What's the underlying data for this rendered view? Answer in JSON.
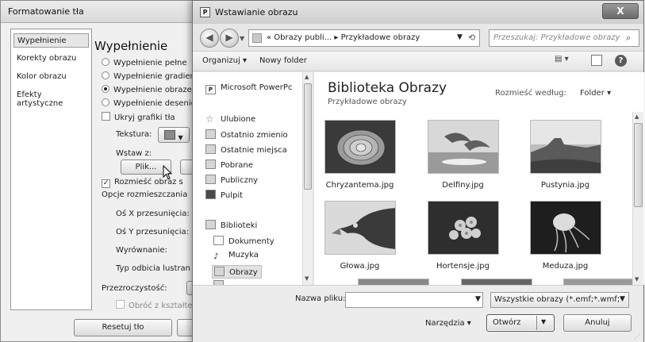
{
  "format_dialog": {
    "title": "Formatowanie tła",
    "nav": [
      "Wypełnienie",
      "Korekty obrazu",
      "Kolor obrazu",
      "Efekty artystyczne"
    ],
    "heading": "Wypełnienie",
    "fill_options": [
      "Wypełnienie pełne",
      "Wypełnienie gradient",
      "Wypełnienie obrazem",
      "Wypełnienie desenie"
    ],
    "hide_graphics": "Ukryj grafiki tła",
    "texture_label": "Tekstura:",
    "insert_from": "Wstaw z:",
    "file_button": "Plik...",
    "tile_checkbox": "Rozmieść obraz s",
    "tile_options": "Opcje rozmieszczania",
    "offset_x": "Oś X przesunięcia:",
    "offset_y": "Oś Y przesunięcia:",
    "alignment": "Wyrównanie:",
    "mirror_type": "Typ odbicia lustran",
    "transparency": "Przezroczystość:",
    "rotate_with_shape": "Obróć z kształtem",
    "reset_button": "Resetuj tło"
  },
  "insert_dialog": {
    "title": "Wstawianie obrazu",
    "app_icon_letter": "P",
    "close_glyph": "X",
    "address": "« Obrazy publi... ▸ Przykładowe obrazy",
    "search_placeholder": "Przeszukaj: Przykładowe obrazy",
    "toolbar": {
      "organize": "Organizuj ▾",
      "new_folder": "Nowy folder"
    },
    "nav_pane": [
      {
        "label": "Microsoft PowerPc",
        "icon": "powerpoint-icon"
      },
      {
        "label": "Ulubione",
        "icon": "star-icon"
      },
      {
        "label": "Ostatnio zmienio",
        "icon": "recent-icon"
      },
      {
        "label": "Ostatnie miejsca",
        "icon": "places-icon"
      },
      {
        "label": "Pobrane",
        "icon": "downloads-icon"
      },
      {
        "label": "Publiczny",
        "icon": "public-folder-icon"
      },
      {
        "label": "Pulpit",
        "icon": "desktop-icon"
      },
      {
        "label": "Biblioteki",
        "icon": "libraries-icon"
      },
      {
        "label": "Dokumenty",
        "icon": "documents-icon"
      },
      {
        "label": "Muzyka",
        "icon": "music-icon"
      },
      {
        "label": "Obrazy",
        "icon": "pictures-icon"
      }
    ],
    "library_title": "Biblioteka Obrazy",
    "library_subtitle": "Przykładowe obrazy",
    "arrange_label": "Rozmieść według:",
    "arrange_value": "Folder ▾",
    "files": [
      {
        "name": "Chryzantema.jpg",
        "motif": "flower"
      },
      {
        "name": "Delfiny.jpg",
        "motif": "dolphins"
      },
      {
        "name": "Pustynia.jpg",
        "motif": "desert"
      },
      {
        "name": "Głowa.jpg",
        "motif": "eagle"
      },
      {
        "name": "Hortensje.jpg",
        "motif": "hydrangea"
      },
      {
        "name": "Meduza.jpg",
        "motif": "jellyfish"
      }
    ],
    "filename_label": "Nazwa pliku:",
    "filename_value": "",
    "file_type": "Wszystkie obrazy (*.emf;*.wmf;",
    "tools": "Narzędzia ▾",
    "open_button": "Otwórz",
    "cancel_button": "Anuluj"
  }
}
